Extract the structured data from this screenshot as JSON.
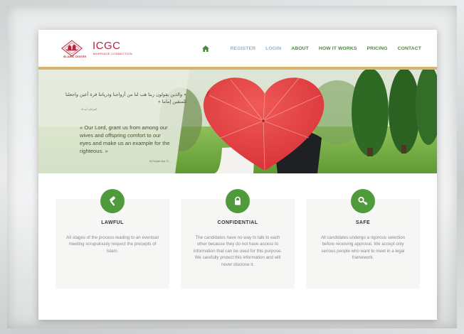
{
  "brand": {
    "logo_sub": "ISLAMIC CENTER",
    "title": "ICGC",
    "tagline": "MARRIAGE CONNECTION",
    "accent": "#b0273a"
  },
  "nav": {
    "home_icon": "home-icon",
    "items": [
      {
        "label": "REGISTER",
        "muted": true
      },
      {
        "label": "LOGIN",
        "muted": true
      },
      {
        "label": "ABOUT",
        "muted": false
      },
      {
        "label": "HOW IT WORKS",
        "muted": false
      },
      {
        "label": "PRICING",
        "muted": false
      },
      {
        "label": "CONTACT",
        "muted": false
      }
    ],
    "color": "#4a8a3a"
  },
  "hero": {
    "arabic": "« والذين يقولون ربنا هب لنا من أزواجنا وذرياتنا قرة أعين واجعلنا للمتقين إماما »",
    "arabic_ref": "الفرقان، آية ٧٤",
    "quote": "« Our Lord, grant us from among our wives and offspring comfort to our eyes and make us an example for the righteous. »",
    "quote_ref": "Al-Furqan Aya 74"
  },
  "features": [
    {
      "icon": "gavel-icon",
      "title": "LAWFUL",
      "text": "All stages of the process leading to an eventual meeting scrupulously respect the precepts of Islam."
    },
    {
      "icon": "lock-icon",
      "title": "CONFIDENTIAL",
      "text": "The candidates have no way to talk to each other because they do not have access to information that can be used for this purpose. We carefully protect this information and will never disclose it."
    },
    {
      "icon": "key-icon",
      "title": "SAFE",
      "text": "All candidates undergo a rigorous selection before receiving approval. We accept only serious people who want to meet in a legal framework."
    }
  ],
  "colors": {
    "green": "#4f9a3b",
    "gold": "#d7b46a"
  }
}
